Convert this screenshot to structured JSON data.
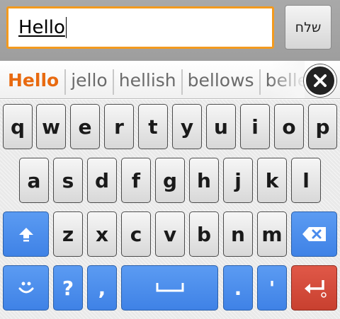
{
  "compose": {
    "input_value": "Hello",
    "send_label": "שלח"
  },
  "suggestions": {
    "items": [
      "Hello",
      "jello",
      "hellish",
      "bellows",
      "belle"
    ]
  },
  "keyboard": {
    "row1": [
      "q",
      "w",
      "e",
      "r",
      "t",
      "y",
      "u",
      "i",
      "o",
      "p"
    ],
    "row2": [
      "a",
      "s",
      "d",
      "f",
      "g",
      "h",
      "j",
      "k",
      "l"
    ],
    "row3": [
      "z",
      "x",
      "c",
      "v",
      "b",
      "n",
      "m"
    ],
    "symbols": {
      "question": "?",
      "comma": ",",
      "period": ".",
      "apostrophe": "'"
    },
    "icons": {
      "shift": "shift-arrow-icon",
      "delete": "backspace-icon",
      "emoji": "smiley-icon",
      "space": "space-bar-icon",
      "enter": "enter-arrow-icon",
      "close": "close-circle-icon"
    },
    "colors": {
      "function_key": "#4a8bec",
      "enter_key": "#d64c3b",
      "suggestion_primary": "#e86a10",
      "input_border": "#f39a1e"
    }
  }
}
